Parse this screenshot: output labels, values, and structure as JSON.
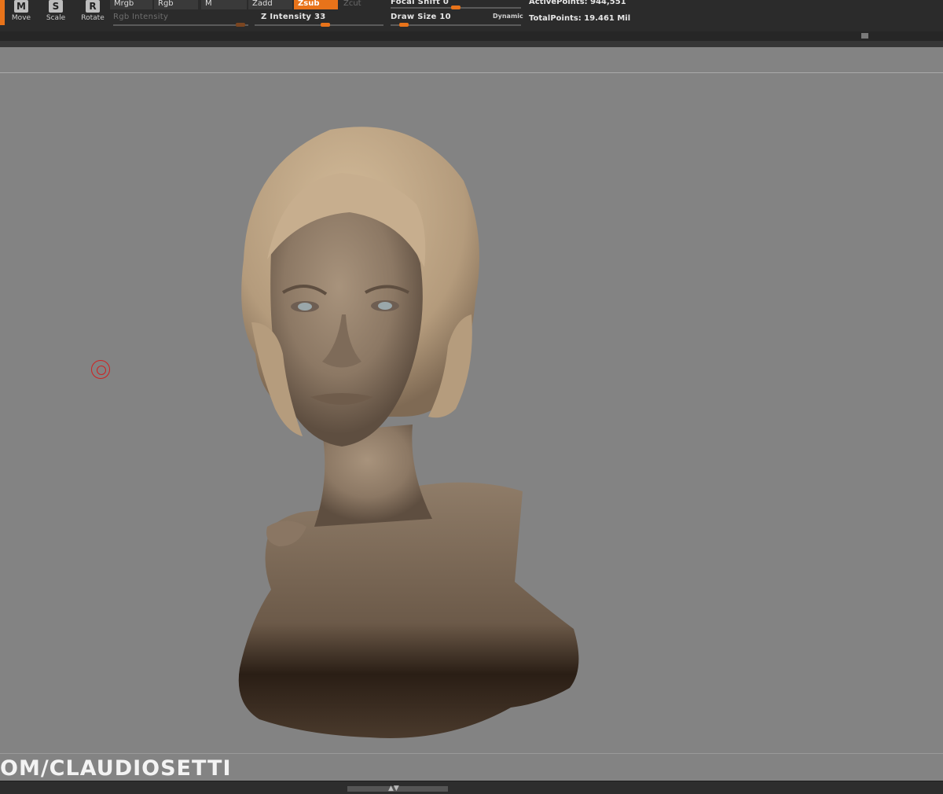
{
  "toolbar": {
    "tools": [
      {
        "key": "M",
        "label": "Move"
      },
      {
        "key": "S",
        "label": "Scale"
      },
      {
        "key": "R",
        "label": "Rotate"
      }
    ],
    "modes": {
      "mrgb": "Mrgb",
      "rgb": "Rgb",
      "m": "M",
      "zadd": "Zadd",
      "zsub": "Zsub",
      "zcut": "Zcut"
    },
    "rgb_intensity": {
      "label": "Rgb Intensity"
    },
    "z_intensity": {
      "label": "Z Intensity 33",
      "value": 33
    },
    "focal_shift": {
      "label": "Focal Shift 0",
      "value": 0
    },
    "draw_size": {
      "label": "Draw Size 10",
      "value": 10
    },
    "dynamic_label": "Dynamic",
    "active_points": "ActivePoints: 944,551",
    "total_points": "TotalPoints: 19.461 Mil"
  },
  "watermark": "OM/CLAUDIOSETTI",
  "colors": {
    "accent": "#e8731a",
    "canvas": "#838383",
    "panel": "#2b2b2b",
    "skin": "#9e8a74"
  }
}
